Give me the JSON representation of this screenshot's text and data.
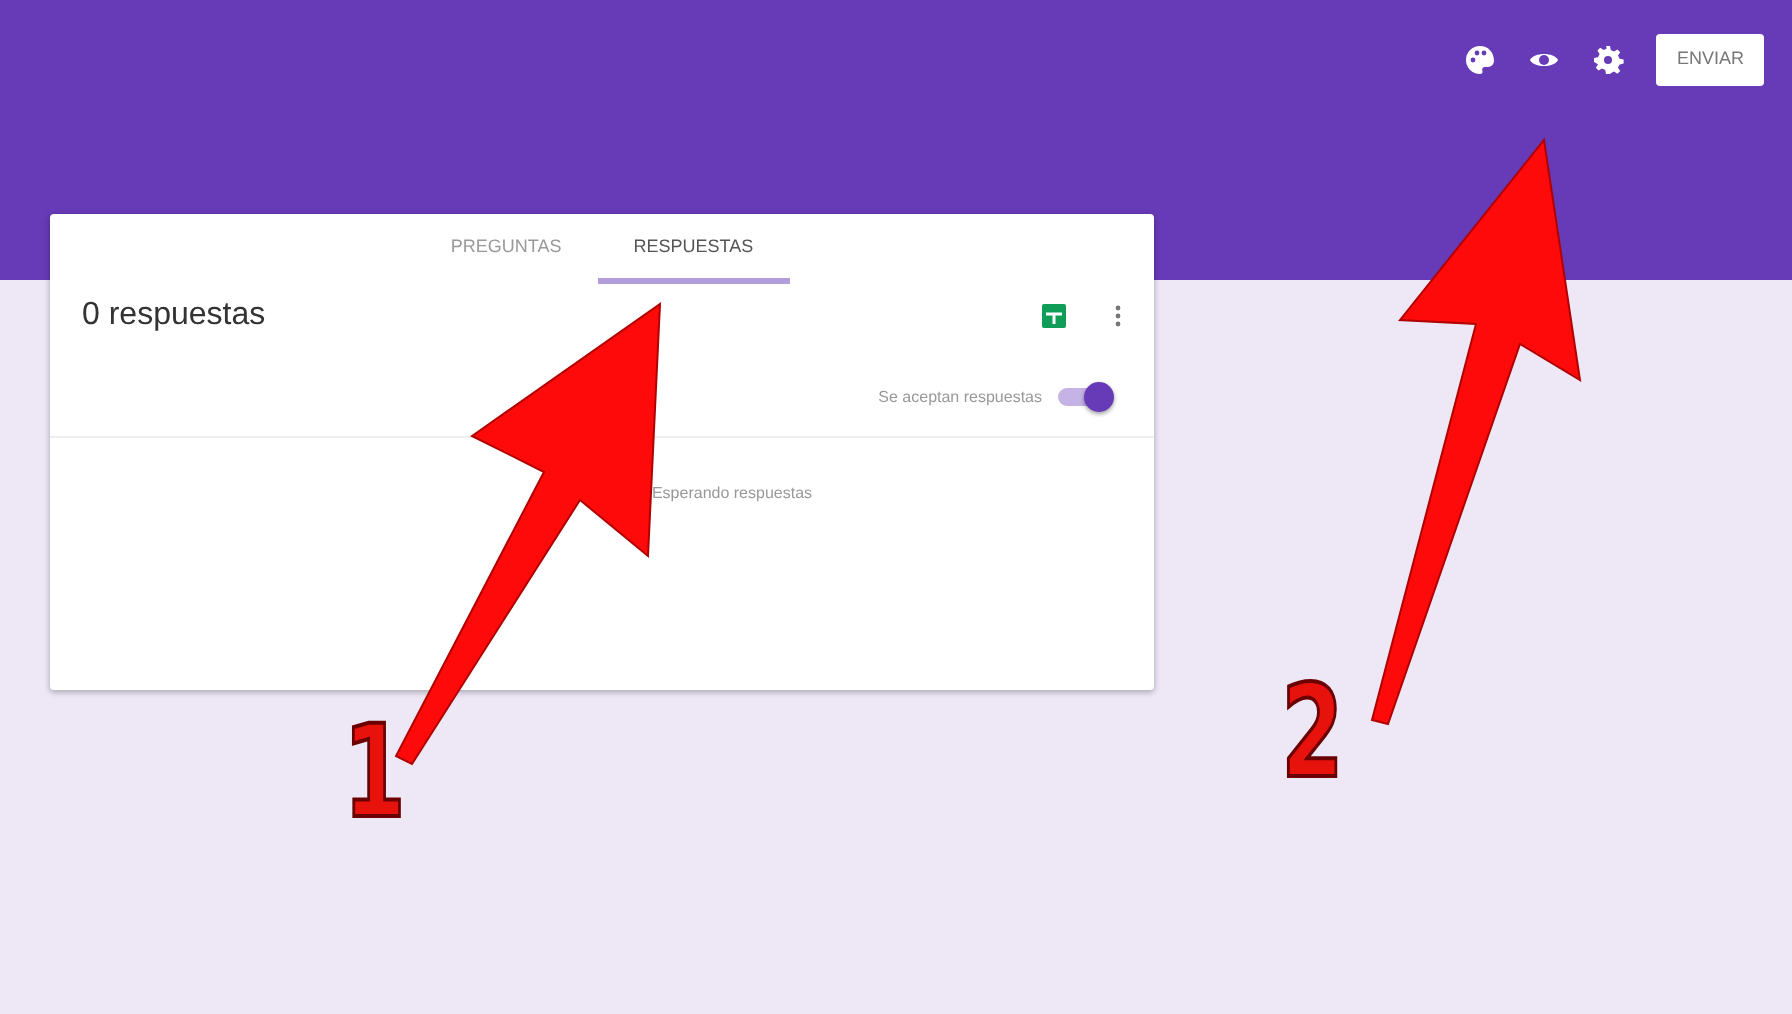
{
  "header": {
    "send_button": "ENVIAR"
  },
  "tabs": [
    {
      "label": "PREGUNTAS",
      "selected": false
    },
    {
      "label": "RESPUESTAS",
      "selected": true
    }
  ],
  "responses": {
    "title": "0 respuestas",
    "accepting": {
      "label": "Se aceptan respuestas",
      "on": true
    },
    "empty_message": "Esperando respuestas"
  },
  "annotations": [
    {
      "label": "1"
    },
    {
      "label": "2"
    }
  ]
}
